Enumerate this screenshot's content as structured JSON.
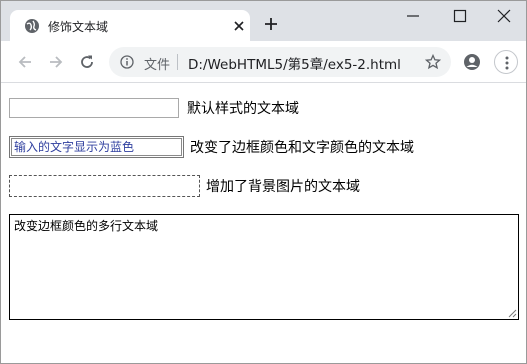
{
  "browser": {
    "tab_title": "修饰文本域",
    "omnibox_file_label": "文件",
    "url": "D:/WebHTML5/第5章/ex5-2.html"
  },
  "page": {
    "field1_label": "默认样式的文本域",
    "field2_value": "输入的文字显示为蓝色",
    "field2_label": "改变了边框颜色和文字颜色的文本域",
    "field3_label": "增加了背景图片的文本域",
    "textarea_value": "改变边框颜色的多行文本域"
  },
  "colors": {
    "tabstrip_bg": "#dee1e6",
    "omnibox_bg": "#f1f3f4",
    "field2_text": "#2f3f9f"
  },
  "icons": [
    "globe-icon",
    "close-icon",
    "plus-icon",
    "minimize-icon",
    "maximize-icon",
    "window-close-icon",
    "back-arrow-icon",
    "forward-arrow-icon",
    "reload-icon",
    "info-icon",
    "star-icon",
    "profile-icon",
    "more-vert-icon",
    "resize-grip-icon"
  ]
}
